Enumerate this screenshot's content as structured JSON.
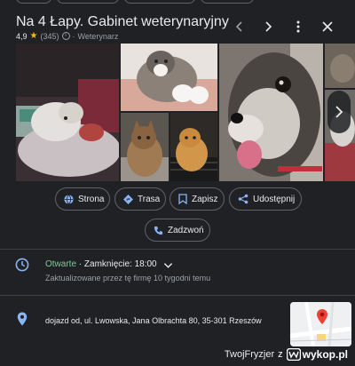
{
  "header": {
    "title": "Na 4 Łapy. Gabinet weterynaryjny",
    "rating": "4,9",
    "reviews": "(345)",
    "category": "Weterynarz"
  },
  "icons": {
    "prev": "chevron-left-icon",
    "next": "chevron-right-icon",
    "more": "more-vert-icon",
    "close": "close-icon"
  },
  "actions": [
    {
      "label": "Strona",
      "icon": "globe-icon"
    },
    {
      "label": "Trasa",
      "icon": "directions-icon"
    },
    {
      "label": "Zapisz",
      "icon": "bookmark-icon"
    },
    {
      "label": "Udostępnij",
      "icon": "share-icon"
    },
    {
      "label": "Zadzwoń",
      "icon": "phone-icon"
    }
  ],
  "hours": {
    "status": "Otwarte",
    "separator": " · ",
    "closing": "Zamknięcie: 18:00",
    "updated": "Zaktualizowane przez tę firmę 10 tygodni temu"
  },
  "address": {
    "text": "dojazd od, ul. Lwowska, Jana Olbrachta 80, 35-301 Rzeszów"
  },
  "watermark": {
    "user": "TwojFryzjer",
    "suffix": "z",
    "site": "wykop.pl"
  },
  "colors": {
    "background": "#202124",
    "accent": "#8ab4f8",
    "open": "#81c995",
    "star": "#fbbc04",
    "pin": "#ea4335"
  }
}
